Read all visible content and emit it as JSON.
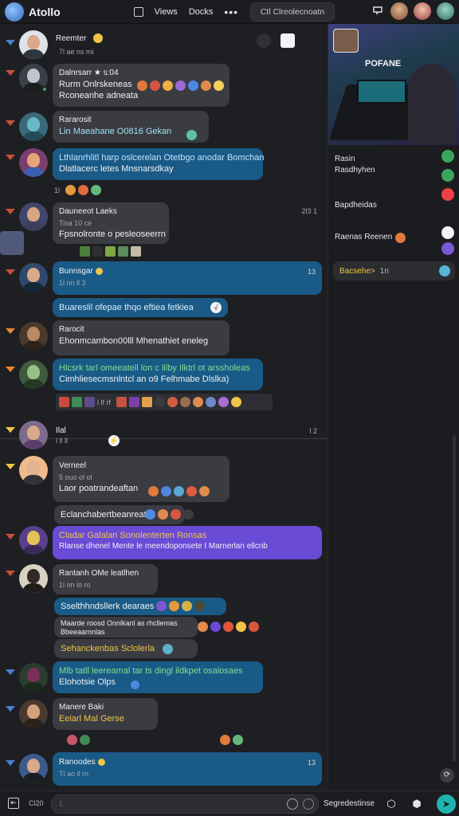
{
  "app": {
    "title": "Atollo"
  },
  "topbar": {
    "link1": "Views",
    "link2": "Docks",
    "more": "•••",
    "search_placeholder": "Ctl Clreolecnoatn",
    "inbox_icon": "inbox-icon"
  },
  "messages": [
    {
      "name": "Reemter",
      "time": "7l  ae  ns  mi",
      "lines": [],
      "side_time": "",
      "bubble": "none"
    },
    {
      "name": "Dalnrsarr  ★  s:04",
      "time": "",
      "lines": [
        "Rurm Onlrskeneas",
        "Rconeanhe  adneata"
      ],
      "bubble": "gray"
    },
    {
      "name": "Rararosit",
      "time": "",
      "lines": [
        "Lin Maeahane  O0816  Gekan"
      ],
      "bubble": "gray",
      "line_class": "mixed"
    },
    {
      "name": "",
      "time": "",
      "lines": [
        "Lthlanrhlitl  harp  oslcerelan  Otetbgo  anodar  Bomchan",
        "Dlatlacerc  letes  Mnsnarsdkay"
      ],
      "bubble": "blue",
      "reactions": "1l"
    },
    {
      "name": "Dauneeot  Laeks",
      "time": "Tisa  10  ce",
      "lines": [
        "Fpsnolronte  o  pesleoseerrn"
      ],
      "bubble": "gray",
      "side_time": "2l3  1"
    },
    {
      "name": "Bunnsgar",
      "time": "1l  nn  ll  3",
      "lines": [],
      "side_time": "13",
      "bubble": "blue-wide"
    },
    {
      "name": "",
      "time": "",
      "lines": [
        "Buareslil  ofepae  thqo  eftiea  fetkiea"
      ],
      "bubble": "blue",
      "chip": "√"
    },
    {
      "name": "Rarocit",
      "time": "",
      "lines": [
        "Ehonmcambon00lll  Mhenathiet  eneleg"
      ],
      "bubble": "gray"
    },
    {
      "name": "",
      "time": "",
      "lines": [
        "Hlcsrk  tarl  omeeatell  lon  c  lilby  Ilktrl  ot  arssholeas",
        "Cimhliesecmsnlntcl  an  o9  Felhmabe  Dlslka)"
      ],
      "bubble": "blue",
      "reactions": "l  lf  rf"
    },
    {
      "name": "Ilal",
      "time": "",
      "lines": [],
      "side_time": "l  2",
      "bubble": "none"
    },
    {
      "name": "Verneel",
      "time": "5  ouo  ol  ol",
      "lines": [
        "Laor  poatrandeaftan"
      ],
      "bubble": "gray"
    },
    {
      "name": "",
      "time": "",
      "lines": [
        "Eclanchabertbeanreate"
      ],
      "bubble": "gray"
    },
    {
      "name": "",
      "time": "",
      "lines": [
        "Cladar  Galalan  Sonolenterten  Ronsas",
        "Rlanse  dhenel  Mente  le  meendoponsete  I  Marnerlan  ellcnb"
      ],
      "bubble": "purple"
    },
    {
      "name": "Rantanh  OMe  leatlhen",
      "time": "1l  on  lo  ro",
      "lines": [],
      "bubble": "gray"
    },
    {
      "name": "",
      "time": "",
      "lines": [
        "Sselthhndsllerk  dearaes"
      ],
      "bubble": "blue"
    },
    {
      "name": "",
      "time": "",
      "lines": [
        "Maarde  roosd  Onnlkanl  as  rhcllemas",
        "Bbeeaarnnlas"
      ],
      "bubble": "gray"
    },
    {
      "name": "",
      "time": "",
      "lines": [
        "Sehanckenbas  Sclolerla"
      ],
      "bubble": "gray"
    },
    {
      "name": "",
      "time": "",
      "lines": [
        "Mlb  tatll  leereamal  tar  ts  dingl  ildkpet  osalosaes",
        "Elohotsie  Olps"
      ],
      "bubble": "blue"
    },
    {
      "name": "Manere  Baki",
      "time": "",
      "lines": [
        "Eeiarl  Mal  Gerse"
      ],
      "bubble": "gray"
    },
    {
      "name": "Ranoodes",
      "time": "Tl  ao  ll  rn",
      "lines": [],
      "side_time": "13",
      "bubble": "blue-wide"
    }
  ],
  "panel": {
    "stream_title": "POFANE",
    "item1": "Rasin",
    "item2": "Rasdhyhen",
    "item3": "Bapdheidas",
    "item4": "Raenas  Reenen",
    "tag_yellow": "Bacsehe>",
    "tag_gray": "1n"
  },
  "bottombar": {
    "left_label": "Cl20",
    "input_placeholder": "l.",
    "right_label": "Segredestinse"
  }
}
